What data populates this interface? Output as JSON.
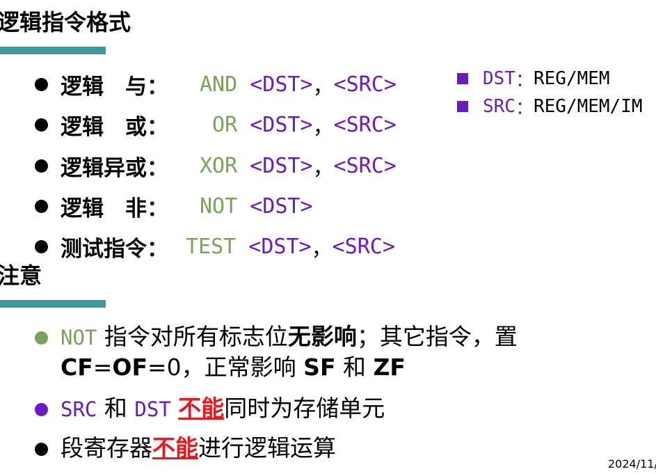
{
  "section1": {
    "title": "逻辑指令格式",
    "bar_color": "#3a9a9e",
    "items": [
      {
        "label": "逻辑　与：",
        "opcode": "AND",
        "operands": [
          {
            "text": " <DST>",
            "cls": "purple"
          },
          {
            "text": "，",
            "cls": ""
          },
          {
            "text": "<SRC>",
            "cls": "purple"
          }
        ]
      },
      {
        "label": "逻辑　或：",
        "opcode": " OR",
        "operands": [
          {
            "text": " <DST>",
            "cls": "purple"
          },
          {
            "text": "，",
            "cls": ""
          },
          {
            "text": "<SRC>",
            "cls": "purple"
          }
        ]
      },
      {
        "label": "逻辑异或：",
        "opcode": "XOR",
        "operands": [
          {
            "text": " <DST>",
            "cls": "purple"
          },
          {
            "text": "，",
            "cls": ""
          },
          {
            "text": "<SRC>",
            "cls": "purple"
          }
        ]
      },
      {
        "label": "逻辑　非：",
        "opcode": "NOT",
        "operands": [
          {
            "text": " <DST>",
            "cls": "purple"
          }
        ]
      },
      {
        "label": "测试指令：",
        "opcode": "TEST",
        "operands": [
          {
            "text": " <DST>",
            "cls": "purple"
          },
          {
            "text": "，",
            "cls": ""
          },
          {
            "text": "<SRC>",
            "cls": "purple"
          }
        ]
      }
    ]
  },
  "side_notes": [
    {
      "key": "DST",
      "sep": "：",
      "value": "REG/MEM"
    },
    {
      "key": "SRC",
      "sep": "：",
      "value": "REG/MEM/IM"
    }
  ],
  "section2": {
    "title": "注意",
    "note1": {
      "opcode": "NOT",
      "t1": " 指令对所有标志位",
      "bold1": "无影响",
      "t2": "；其它指令，置",
      "line2_cf": "CF",
      "line2_eq1": "=",
      "line2_of": "OF",
      "line2_eq2": "=0，正常影响 ",
      "line2_sf": "SF",
      "line2_and": " 和 ",
      "line2_zf": "ZF"
    },
    "note2": {
      "src": "SRC",
      "and": " 和 ",
      "dst": "DST",
      "red": "不能",
      "rest": "同时为存储单元"
    },
    "note3": {
      "t1": "段寄存器",
      "red": "不能",
      "rest": "进行逻辑运算"
    }
  },
  "footer": {
    "date": "2024/11/"
  },
  "colors": {
    "green": "#7aa35a",
    "purple": "#6a1bbf",
    "red": "#e8181e",
    "teal": "#3a9a9e"
  }
}
